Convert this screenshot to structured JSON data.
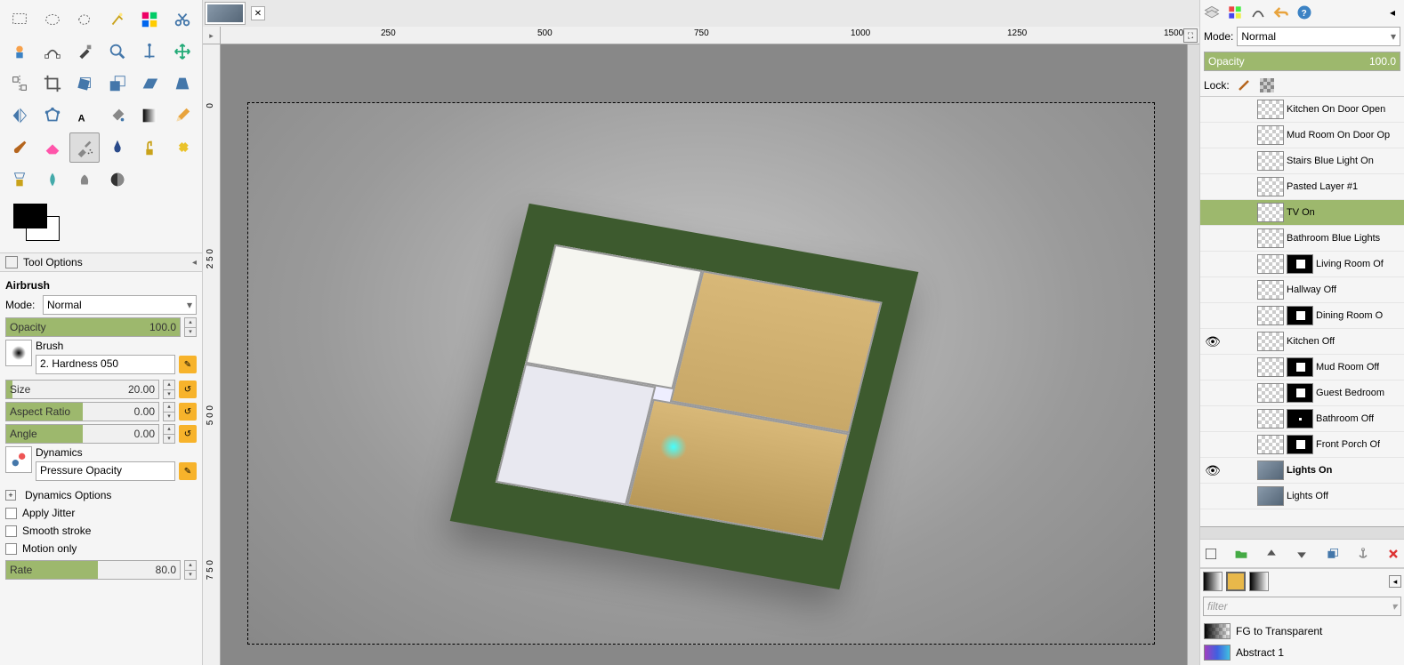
{
  "toolOptions": {
    "header": "Tool Options",
    "toolName": "Airbrush",
    "modeLabel": "Mode:",
    "modeValue": "Normal",
    "opacityLabel": "Opacity",
    "opacityValue": "100.0",
    "brushLabel": "Brush",
    "brushName": "2. Hardness 050",
    "sizeLabel": "Size",
    "sizeValue": "20.00",
    "aspectLabel": "Aspect Ratio",
    "aspectValue": "0.00",
    "angleLabel": "Angle",
    "angleValue": "0.00",
    "dynamicsLabel": "Dynamics",
    "dynamicsValue": "Pressure Opacity",
    "dynamicsOptions": "Dynamics Options",
    "applyJitter": "Apply Jitter",
    "smoothStroke": "Smooth stroke",
    "motionOnly": "Motion only",
    "rateLabel": "Rate",
    "rateValue": "80.0"
  },
  "ruler": {
    "t250": "250",
    "t500": "500",
    "t750": "750",
    "t1000": "1000",
    "t1250": "1250",
    "t1500": "1500",
    "v0a": "0",
    "v250": "2\n5\n0",
    "v500": "5\n0\n0",
    "v750": "7\n5\n0"
  },
  "rightPanel": {
    "modeLabel": "Mode:",
    "modeValue": "Normal",
    "opacityLabel": "Opacity",
    "opacityValue": "100.0",
    "lockLabel": "Lock:",
    "filterPlaceholder": "filter"
  },
  "layers": [
    {
      "name": "Kitchen On Door Open",
      "selected": false,
      "eye": false,
      "mask": false,
      "clipped": true
    },
    {
      "name": "Mud Room On Door Op",
      "selected": false,
      "eye": false,
      "mask": false
    },
    {
      "name": "Stairs Blue Light On",
      "selected": false,
      "eye": false,
      "mask": false
    },
    {
      "name": "Pasted Layer #1",
      "selected": false,
      "eye": false,
      "mask": false
    },
    {
      "name": "TV On",
      "selected": true,
      "eye": false,
      "mask": false
    },
    {
      "name": "Bathroom Blue Lights",
      "selected": false,
      "eye": false,
      "mask": false
    },
    {
      "name": "Living Room Of",
      "selected": false,
      "eye": false,
      "mask": true
    },
    {
      "name": "Hallway Off",
      "selected": false,
      "eye": false,
      "mask": false
    },
    {
      "name": "Dining Room O",
      "selected": false,
      "eye": false,
      "mask": true
    },
    {
      "name": "Kitchen Off",
      "selected": false,
      "eye": true,
      "mask": false
    },
    {
      "name": "Mud Room Off",
      "selected": false,
      "eye": false,
      "mask": true
    },
    {
      "name": "Guest Bedroom",
      "selected": false,
      "eye": false,
      "mask": true
    },
    {
      "name": "Bathroom Off",
      "selected": false,
      "eye": false,
      "mask": true,
      "maskdot": true
    },
    {
      "name": "Front Porch Of",
      "selected": false,
      "eye": false,
      "mask": true
    },
    {
      "name": "Lights On",
      "selected": false,
      "eye": true,
      "mask": false,
      "bold": true,
      "houseimg": true
    },
    {
      "name": "Lights Off",
      "selected": false,
      "eye": false,
      "mask": false,
      "houseimg": true
    }
  ],
  "gradients": {
    "g1": "FG to Transparent",
    "g2": "Abstract 1"
  }
}
